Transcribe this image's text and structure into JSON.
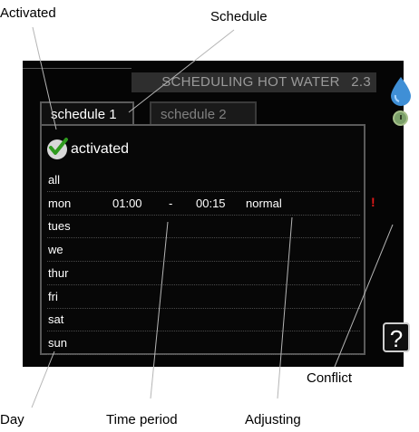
{
  "callouts": {
    "activated": "Activated",
    "schedule": "Schedule",
    "conflict": "Conflict",
    "day": "Day",
    "time_period": "Time period",
    "adjusting": "Adjusting"
  },
  "screen": {
    "title": "SCHEDULING HOT WATER",
    "menu_number": "2.3",
    "tabs": [
      {
        "label": "schedule 1",
        "active": true
      },
      {
        "label": "schedule 2",
        "active": false
      }
    ],
    "activated_label": "activated",
    "activated_checked": true,
    "rows": [
      {
        "day": "all",
        "start": "",
        "sep": "",
        "end": "",
        "mode": ""
      },
      {
        "day": "mon",
        "start": "01:00",
        "sep": "-",
        "end": "00:15",
        "mode": "normal"
      },
      {
        "day": "tues",
        "start": "",
        "sep": "",
        "end": "",
        "mode": ""
      },
      {
        "day": "we",
        "start": "",
        "sep": "",
        "end": "",
        "mode": ""
      },
      {
        "day": "thur",
        "start": "",
        "sep": "",
        "end": "",
        "mode": ""
      },
      {
        "day": "fri",
        "start": "",
        "sep": "",
        "end": "",
        "mode": ""
      },
      {
        "day": "sat",
        "start": "",
        "sep": "",
        "end": "",
        "mode": ""
      },
      {
        "day": "sun",
        "start": "",
        "sep": "",
        "end": "",
        "mode": ""
      }
    ],
    "conflict_marker": "!",
    "help_label": "?",
    "icons": {
      "top_right": "water-drop-icon",
      "below": "clock-icon"
    },
    "colors": {
      "background": "#050505",
      "text": "#ffffff",
      "conflict": "#e51a1a",
      "drop": "#3f8fd6"
    }
  }
}
